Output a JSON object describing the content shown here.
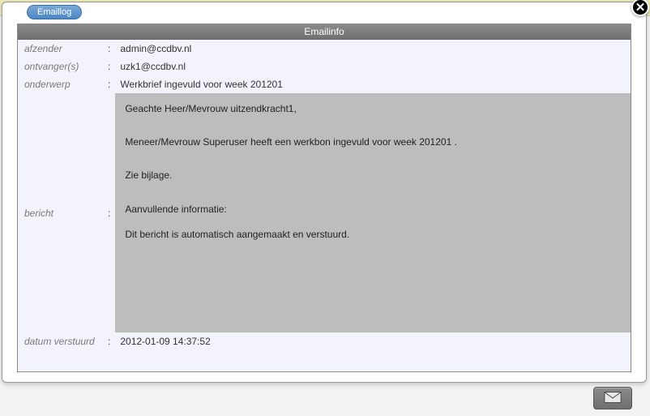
{
  "tab": {
    "label": "Emaillog"
  },
  "panel": {
    "title": "Emailinfo"
  },
  "fields": {
    "sender_label": "afzender",
    "sender_value": "admin@ccdbv.nl",
    "recipient_label": "ontvanger(s)",
    "recipient_value": "uzk1@ccdbv.nl",
    "subject_label": "onderwerp",
    "subject_value": "Werkbrief ingevuld voor week 201201",
    "message_label": "bericht",
    "sent_label": "datum verstuurd",
    "sent_value": "2012-01-09 14:37:52"
  },
  "message": {
    "greeting": "Geachte Heer/Mevrouw uitzendkracht1,",
    "line1": "Meneer/Mevrouw Superuser heeft een werkbon ingevuld voor week 201201 .",
    "line2": "Zie bijlage.",
    "line3": "Aanvullende informatie:",
    "line4": "Dit bericht is automatisch aangemaakt en verstuurd."
  },
  "close_glyph": "✕"
}
